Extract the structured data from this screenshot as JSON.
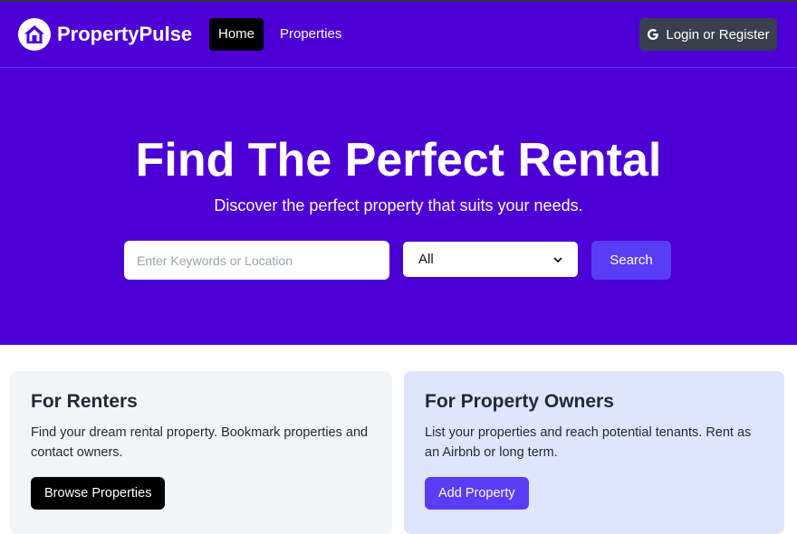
{
  "nav": {
    "brand": "PropertyPulse",
    "links": [
      {
        "label": "Home",
        "active": true
      },
      {
        "label": "Properties",
        "active": false
      }
    ],
    "login_label": "Login or Register",
    "login_icon": "google-icon",
    "logo_icon": "house-icon"
  },
  "hero": {
    "title": "Find The Perfect Rental",
    "subtitle": "Discover the perfect property that suits your needs.",
    "search_placeholder": "Enter Keywords or Location",
    "type_select": "All",
    "search_button": "Search"
  },
  "cards": [
    {
      "title": "For Renters",
      "text": "Find your dream rental property. Bookmark properties and contact owners.",
      "button": "Browse Properties"
    },
    {
      "title": "For Property Owners",
      "text": "List your properties and reach potential tenants. Rent as an Airbnb or long term.",
      "button": "Add Property"
    }
  ],
  "colors": {
    "brand_purple": "#4c00d6",
    "accent": "#5b3cf5",
    "renters_card_bg": "#f3f4f6",
    "owners_card_bg": "#dfe5fd"
  }
}
